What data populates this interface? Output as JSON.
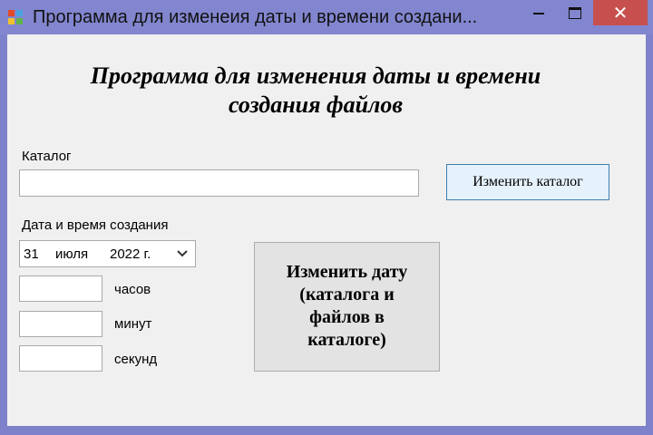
{
  "window": {
    "title": "Программа для изменеия даты и времени создани..."
  },
  "heading": {
    "line1": "Программа для изменения даты и времени",
    "line2": "создания файлов"
  },
  "catalog": {
    "label": "Каталог",
    "value": "",
    "change_button": "Изменить каталог"
  },
  "datetime": {
    "label": "Дата и время создания",
    "picker": {
      "day": "31",
      "month": "июля",
      "year": "2022 г."
    },
    "hours": {
      "value": "",
      "label": "часов"
    },
    "minutes": {
      "value": "",
      "label": "минут"
    },
    "seconds": {
      "value": "",
      "label": "секунд"
    }
  },
  "action_button": {
    "line1": "Изменить дату",
    "line2": "(каталога и",
    "line3": "файлов в",
    "line4": "каталоге)"
  },
  "icons": {
    "app": "app-icon",
    "minimize": "minimize-icon",
    "maximize": "maximize-icon",
    "close": "close-icon",
    "dropdown": "chevron-down-icon"
  },
  "colors": {
    "titlebar": "#8286cf",
    "close": "#c7504f",
    "client": "#f0f0f0",
    "focused_button": "#e5f1fb"
  }
}
